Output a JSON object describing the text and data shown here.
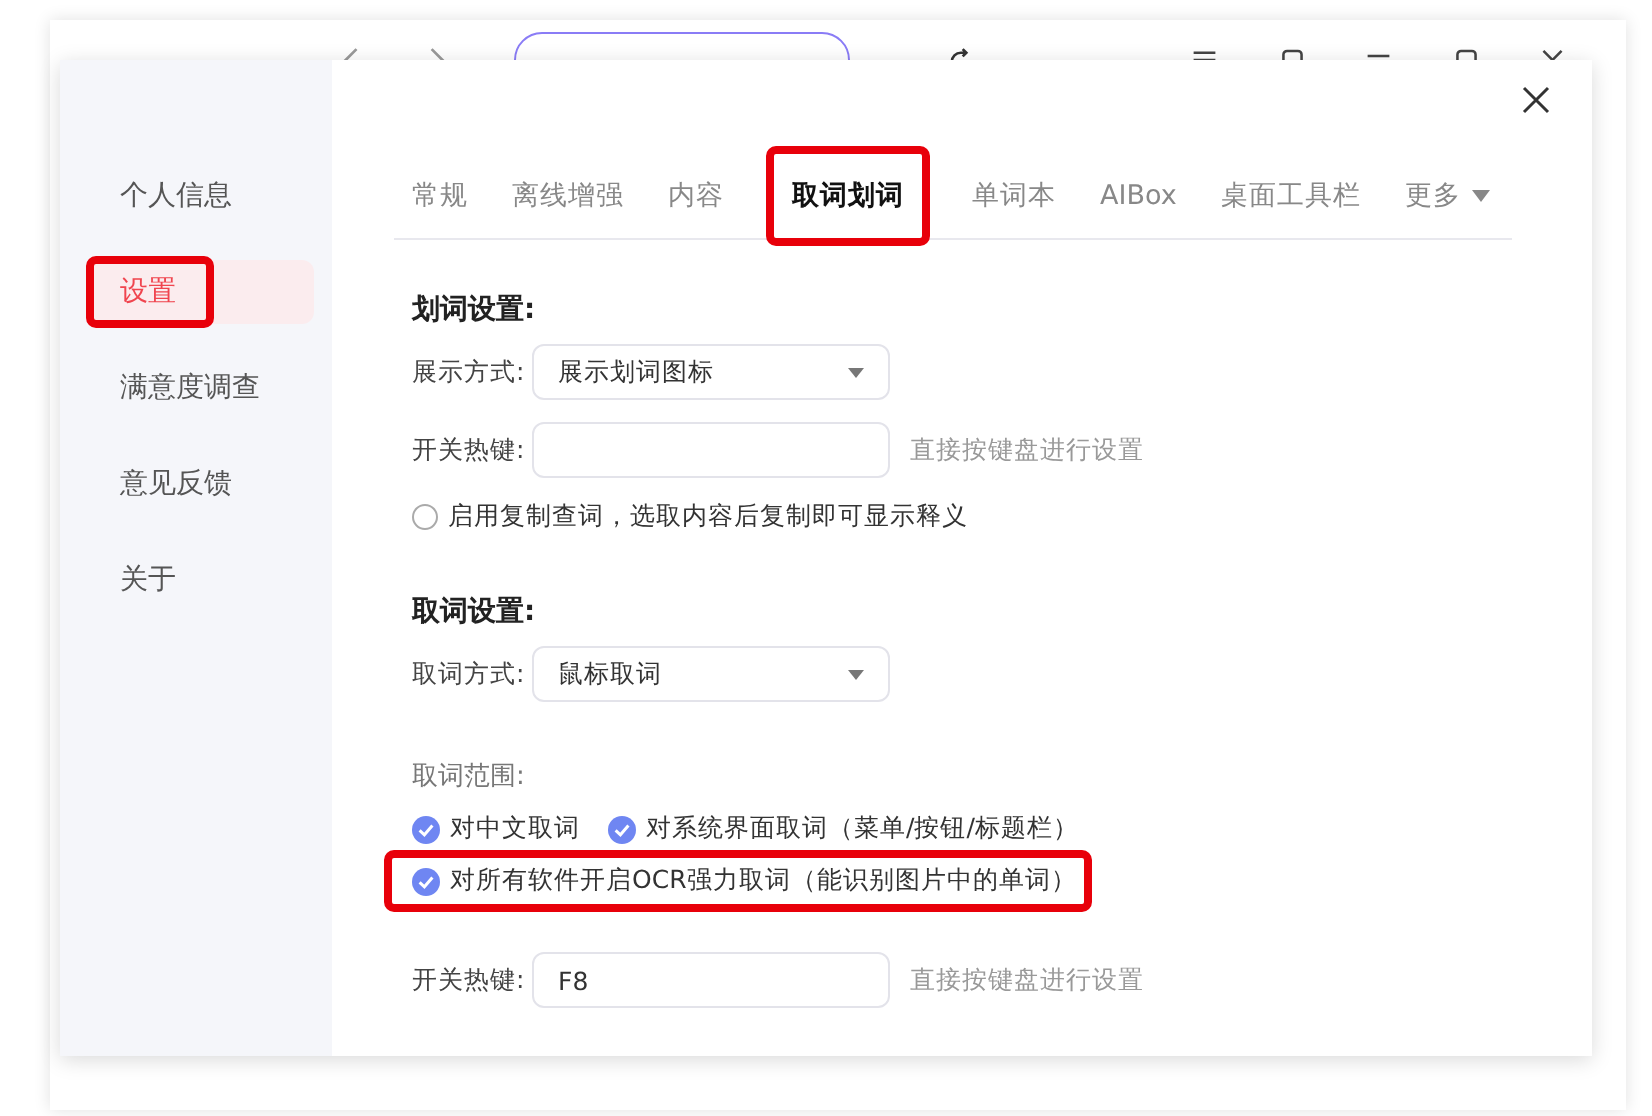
{
  "sidebar": [
    {
      "label": "个人信息",
      "selected": false,
      "highlighted": false
    },
    {
      "label": "设置",
      "selected": true,
      "highlighted": true
    },
    {
      "label": "满意度调查",
      "selected": false,
      "highlighted": false
    },
    {
      "label": "意见反馈",
      "selected": false,
      "highlighted": false
    },
    {
      "label": "关于",
      "selected": false,
      "highlighted": false
    }
  ],
  "tabs": [
    {
      "label": "常规",
      "selected": false,
      "highlighted": false,
      "kind": "tab"
    },
    {
      "label": "离线增强",
      "selected": false,
      "highlighted": false,
      "kind": "tab"
    },
    {
      "label": "内容",
      "selected": false,
      "highlighted": false,
      "kind": "tab"
    },
    {
      "label": "取词划词",
      "selected": true,
      "highlighted": true,
      "kind": "tab"
    },
    {
      "label": "单词本",
      "selected": false,
      "highlighted": false,
      "kind": "tab"
    },
    {
      "label": "AIBox",
      "selected": false,
      "highlighted": false,
      "kind": "tab"
    },
    {
      "label": "桌面工具栏",
      "selected": false,
      "highlighted": false,
      "kind": "tab"
    },
    {
      "label": "更多",
      "selected": false,
      "highlighted": false,
      "kind": "dropdown"
    }
  ],
  "selection_settings": {
    "title": "划词设置:",
    "display": {
      "label": "展示方式:",
      "value": "展示划词图标"
    },
    "hotkey": {
      "label": "开关热键:",
      "hint": "直接按键盘进行设置"
    },
    "copy_lookup": {
      "label": "启用复制查词，选取内容后复制即可显示释义",
      "checked": false
    }
  },
  "pick_settings": {
    "title": "取词设置:",
    "mode": {
      "label": "取词方式:",
      "value": "鼠标取词"
    },
    "range_label": "取词范围:",
    "option_rows": [
      [
        {
          "label": "对中文取词",
          "checked": true,
          "highlighted": false
        },
        {
          "label": "对系统界面取词（菜单/按钮/标题栏）",
          "checked": true,
          "highlighted": false
        }
      ],
      [
        {
          "label": "对所有软件开启OCR强力取词（能识别图片中的单词）",
          "checked": true,
          "highlighted": true
        }
      ]
    ],
    "hotkey": {
      "label": "开关热键:",
      "value": "F8",
      "hint": "直接按键盘进行设置"
    }
  }
}
